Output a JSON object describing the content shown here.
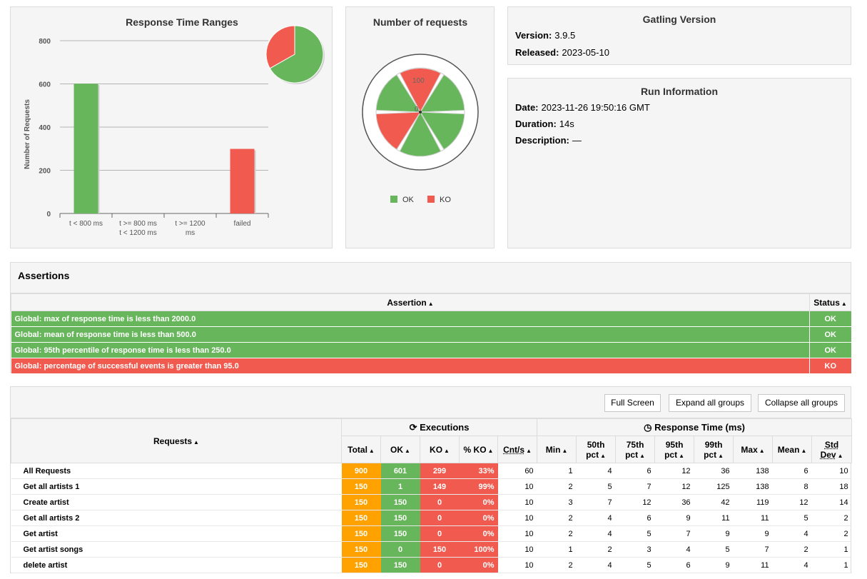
{
  "colors": {
    "ok": "#68b65c",
    "ko": "#f15b4f",
    "total": "#ffa200",
    "panel": "#f5f5f5"
  },
  "response_time_chart": {
    "title": "Response Time Ranges",
    "ylabel": "Number of Requests",
    "yticks": [
      "0",
      "200",
      "400",
      "600",
      "800"
    ],
    "categories": [
      {
        "line1": "t < 800 ms",
        "line2": ""
      },
      {
        "line1": "t >= 800 ms",
        "line2": "t < 1200 ms"
      },
      {
        "line1": "t >= 1200",
        "line2": "ms"
      },
      {
        "line1": "failed",
        "line2": ""
      }
    ]
  },
  "requests_chart": {
    "title": "Number of requests",
    "tick_100": "100",
    "tick_0": "0",
    "legend_ok": "OK",
    "legend_ko": "KO"
  },
  "chart_data": [
    {
      "type": "bar",
      "title": "Response Time Ranges",
      "ylabel": "Number of Requests",
      "ylim": [
        0,
        800
      ],
      "categories": [
        "t < 800 ms",
        "t >= 800 ms t < 1200 ms",
        "t >= 1200 ms",
        "failed"
      ],
      "values": [
        601,
        0,
        0,
        299
      ],
      "bar_colors": [
        "#68b65c",
        "#68b65c",
        "#68b65c",
        "#f15b4f"
      ],
      "inset_pie": {
        "slices": [
          {
            "name": "OK",
            "value": 601
          },
          {
            "name": "KO",
            "value": 299
          }
        ]
      }
    },
    {
      "type": "pie",
      "title": "Number of requests",
      "categories": [
        "Get all artists 1",
        "Create artist",
        "Get all artists 2",
        "Get artist",
        "Get artist songs",
        "delete artist"
      ],
      "series": [
        {
          "name": "OK",
          "values": [
            1,
            150,
            150,
            150,
            0,
            150
          ]
        },
        {
          "name": "KO",
          "values": [
            149,
            0,
            0,
            0,
            150,
            0
          ]
        }
      ],
      "radial_ticks": [
        0,
        100
      ]
    }
  ],
  "gatling": {
    "title": "Gatling Version",
    "version_label": "Version:",
    "version": "3.9.5",
    "released_label": "Released:",
    "released": "2023-05-10"
  },
  "run": {
    "title": "Run Information",
    "date_label": "Date:",
    "date": "2023-11-26 19:50:16 GMT",
    "duration_label": "Duration:",
    "duration": "14s",
    "description_label": "Description:",
    "description": "—"
  },
  "assertions": {
    "title": "Assertions",
    "col_assertion": "Assertion",
    "col_status": "Status",
    "rows": [
      {
        "text": "Global: max of response time is less than 2000.0",
        "status": "OK"
      },
      {
        "text": "Global: mean of response time is less than 500.0",
        "status": "OK"
      },
      {
        "text": "Global: 95th percentile of response time is less than 250.0",
        "status": "OK"
      },
      {
        "text": "Global: percentage of successful events is greater than 95.0",
        "status": "KO"
      }
    ]
  },
  "stats": {
    "buttons": {
      "full_screen": "Full Screen",
      "expand": "Expand all groups",
      "collapse": "Collapse all groups"
    },
    "col_requests": "Requests",
    "col_executions": "Executions",
    "col_response_time": "Response Time (ms)",
    "cols": {
      "total": "Total",
      "ok": "OK",
      "ko": "KO",
      "pct_ko": "% KO",
      "cnts": "Cnt/s",
      "min": "Min",
      "p50_a": "50th",
      "p50_b": "pct",
      "p75_a": "75th",
      "p75_b": "pct",
      "p95_a": "95th",
      "p95_b": "pct",
      "p99_a": "99th",
      "p99_b": "pct",
      "max": "Max",
      "mean": "Mean",
      "std_a": "Std",
      "std_b": "Dev"
    },
    "rows": [
      {
        "name": "All Requests",
        "total": "900",
        "ok": "601",
        "ko": "299",
        "pct": "33%",
        "cnts": "60",
        "min": "1",
        "p50": "4",
        "p75": "6",
        "p95": "12",
        "p99": "36",
        "max": "138",
        "mean": "6",
        "std": "10"
      },
      {
        "name": "Get all artists 1",
        "total": "150",
        "ok": "1",
        "ko": "149",
        "pct": "99%",
        "cnts": "10",
        "min": "2",
        "p50": "5",
        "p75": "7",
        "p95": "12",
        "p99": "125",
        "max": "138",
        "mean": "8",
        "std": "18"
      },
      {
        "name": "Create artist",
        "total": "150",
        "ok": "150",
        "ko": "0",
        "pct": "0%",
        "cnts": "10",
        "min": "3",
        "p50": "7",
        "p75": "12",
        "p95": "36",
        "p99": "42",
        "max": "119",
        "mean": "12",
        "std": "14"
      },
      {
        "name": "Get all artists 2",
        "total": "150",
        "ok": "150",
        "ko": "0",
        "pct": "0%",
        "cnts": "10",
        "min": "2",
        "p50": "4",
        "p75": "6",
        "p95": "9",
        "p99": "11",
        "max": "11",
        "mean": "5",
        "std": "2"
      },
      {
        "name": "Get artist",
        "total": "150",
        "ok": "150",
        "ko": "0",
        "pct": "0%",
        "cnts": "10",
        "min": "2",
        "p50": "4",
        "p75": "5",
        "p95": "7",
        "p99": "9",
        "max": "9",
        "mean": "4",
        "std": "2"
      },
      {
        "name": "Get artist songs",
        "total": "150",
        "ok": "0",
        "ko": "150",
        "pct": "100%",
        "cnts": "10",
        "min": "1",
        "p50": "2",
        "p75": "3",
        "p95": "4",
        "p99": "5",
        "max": "7",
        "mean": "2",
        "std": "1"
      },
      {
        "name": "delete artist",
        "total": "150",
        "ok": "150",
        "ko": "0",
        "pct": "0%",
        "cnts": "10",
        "min": "2",
        "p50": "4",
        "p75": "5",
        "p95": "6",
        "p99": "9",
        "max": "11",
        "mean": "4",
        "std": "1"
      }
    ]
  }
}
